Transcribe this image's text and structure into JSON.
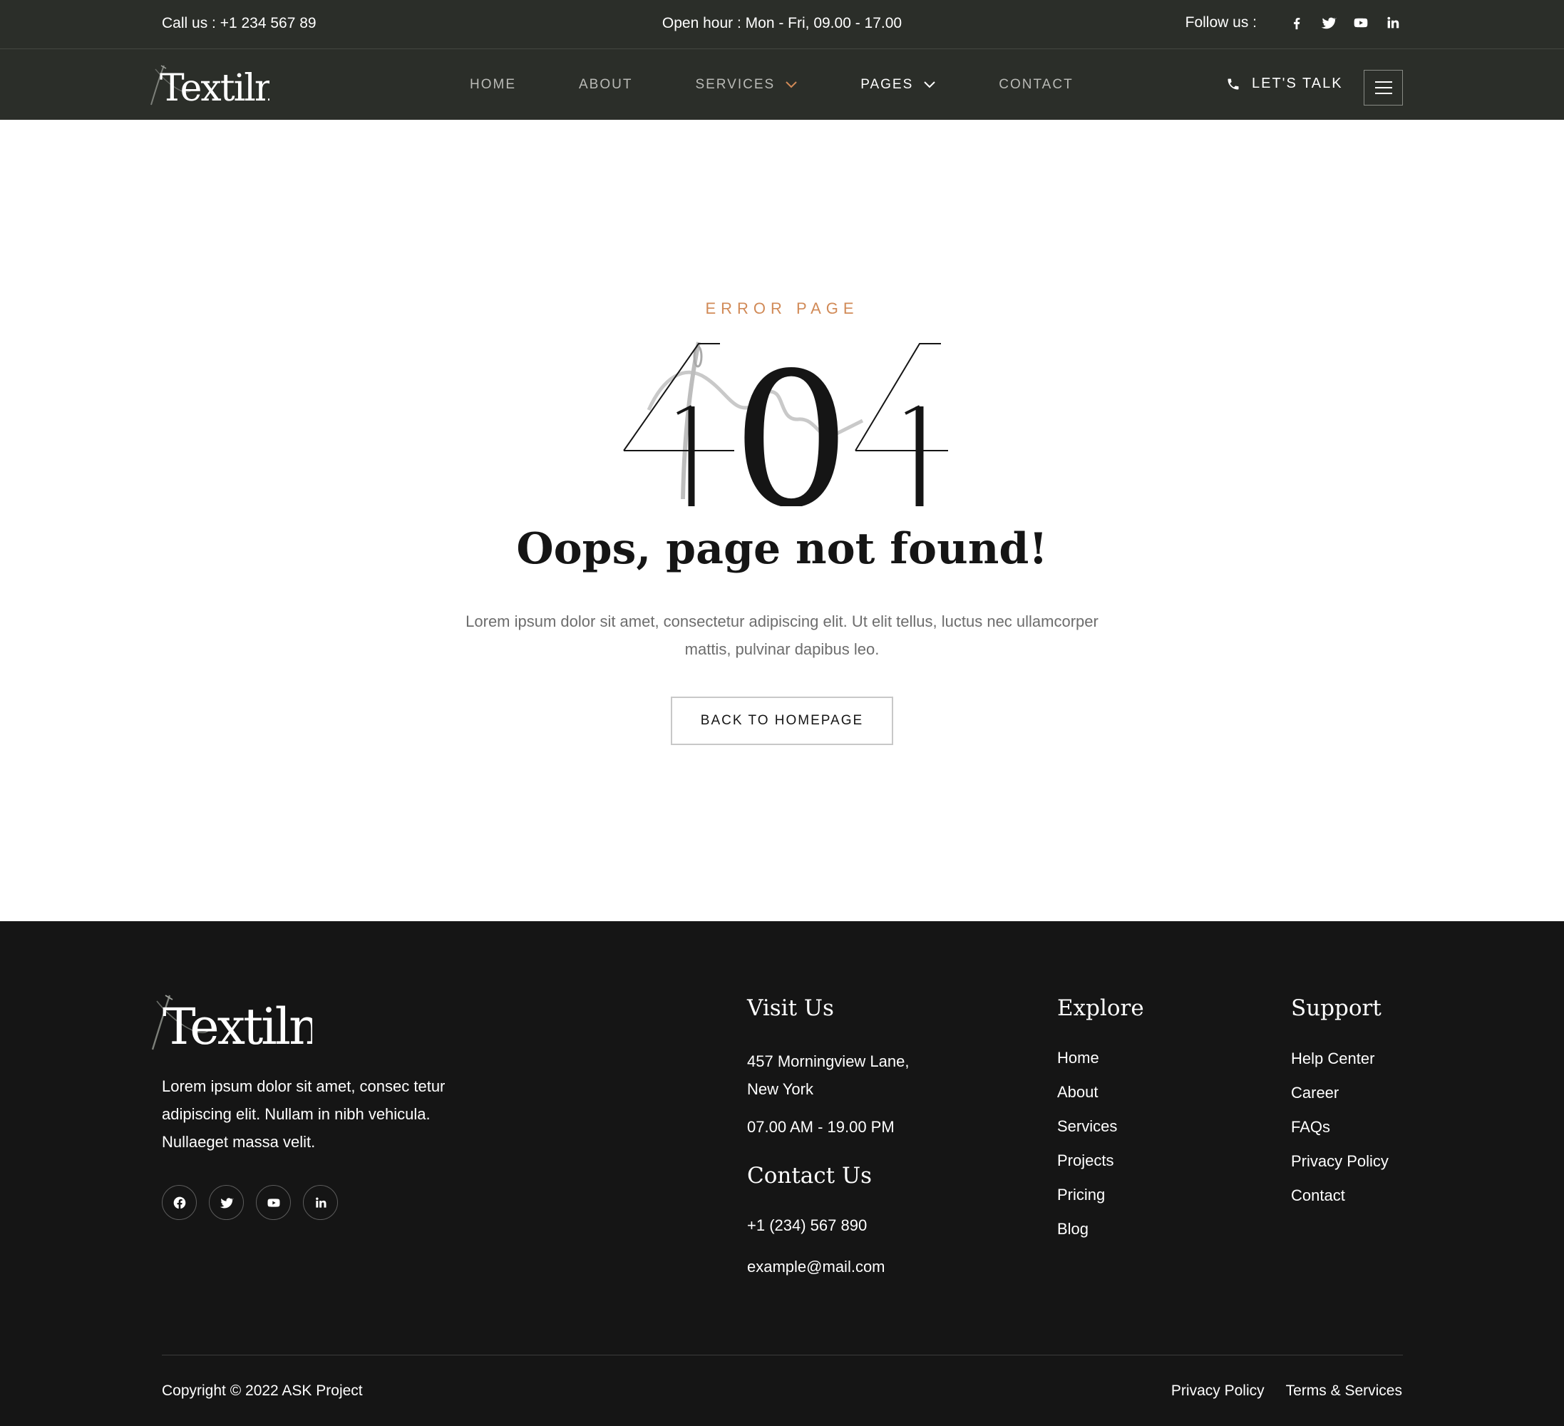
{
  "topbar": {
    "call": "Call us : +1 234 567 89",
    "hours": "Open hour : Mon - Fri, 09.00 - 17.00",
    "follow_label": "Follow us :",
    "social_icons": [
      "facebook-icon",
      "twitter-icon",
      "youtube-icon",
      "linkedin-icon"
    ]
  },
  "nav": {
    "logo_text": "Textiln",
    "items": [
      {
        "label": "HOME",
        "dropdown": false
      },
      {
        "label": "ABOUT",
        "dropdown": false
      },
      {
        "label": "SERVICES",
        "dropdown": true
      },
      {
        "label": "PAGES",
        "dropdown": true,
        "active": true
      },
      {
        "label": "CONTACT",
        "dropdown": false
      }
    ],
    "cta_label": "LET'S TALK"
  },
  "error": {
    "eyebrow": "ERROR PAGE",
    "code": "404",
    "heading": "Oops, page not found!",
    "description": "Lorem ipsum dolor sit amet, consectetur adipiscing elit. Ut elit tellus, luctus nec ullamcorper mattis, pulvinar dapibus leo.",
    "button_label": "BACK TO HOMEPAGE"
  },
  "footer": {
    "logo_text": "Textiln",
    "about": "Lorem ipsum dolor sit amet, consec tetur adipiscing elit. Nullam in nibh vehicula. Nullaeget massa velit.",
    "social_icons": [
      "facebook-icon",
      "twitter-icon",
      "youtube-icon",
      "linkedin-icon"
    ],
    "visit": {
      "title": "Visit Us",
      "address_line1": "457 Morningview Lane,",
      "address_line2": "New York",
      "hours": "07.00 AM - 19.00 PM"
    },
    "contact": {
      "title": "Contact Us",
      "phone": "+1 (234) 567 890",
      "email": "example@mail.com"
    },
    "explore": {
      "title": "Explore",
      "links": [
        "Home",
        "About",
        "Services",
        "Projects",
        "Pricing",
        "Blog"
      ]
    },
    "support": {
      "title": "Support",
      "links": [
        "Help Center",
        "Career",
        "FAQs",
        "Privacy Policy",
        "Contact"
      ]
    },
    "copyright": "Copyright © 2022 ASK Project",
    "legal_links": [
      "Privacy Policy",
      "Terms & Services"
    ]
  },
  "colors": {
    "header_bg": "#2b2e29",
    "footer_bg": "#151515",
    "accent": "#d18a57"
  }
}
